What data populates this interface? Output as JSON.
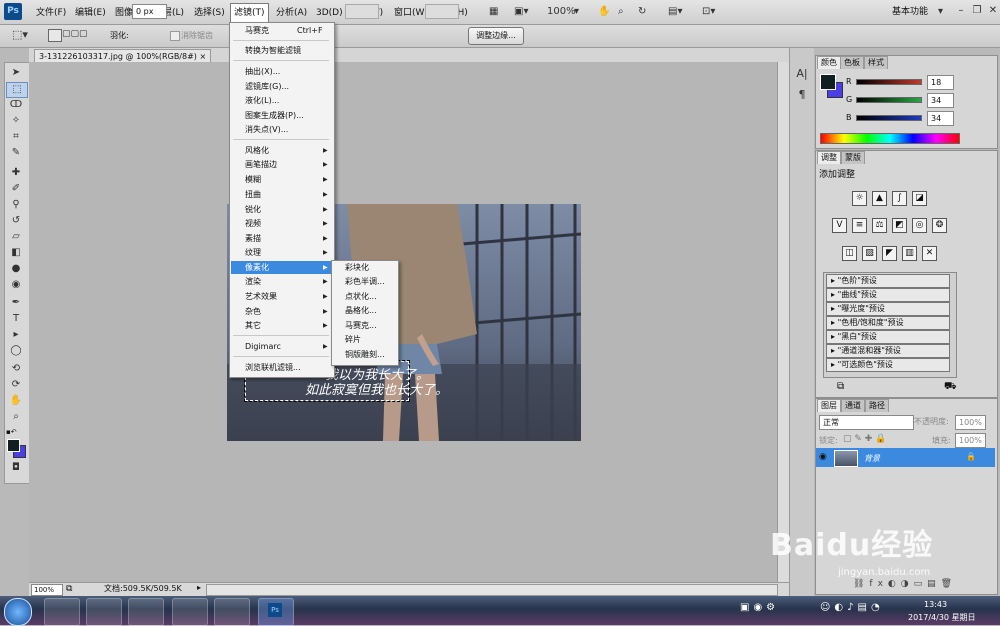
{
  "app": {
    "logo": "Ps"
  },
  "menubar": {
    "items": [
      "文件(F)",
      "编辑(E)",
      "图像(I)",
      "图层(L)",
      "选择(S)",
      "滤镜(T)",
      "分析(A)",
      "3D(D)",
      "视图(V)",
      "窗口(W)",
      "帮助(H)"
    ],
    "zoom_value": "100%",
    "workspace": "基本功能"
  },
  "options_bar": {
    "feather_label": "羽化:",
    "feather_value": "0 px",
    "antialias_label": "消除锯齿",
    "refine_edge_button": "调整边缘..."
  },
  "document": {
    "tab_title": "3-131226103317.jpg @ 100%(RGB/8#)",
    "photo_text_1": "我以为我长大了。",
    "photo_text_2": "如此寂寞但我也长大了。",
    "zoom": "100%",
    "doc_size": "文档:509.5K/509.5K"
  },
  "filter_menu": {
    "last_filter": "马赛克",
    "last_filter_shortcut": "Ctrl+F",
    "smart_filter": "转换为智能滤镜",
    "group1": [
      "抽出(X)...",
      "滤镜库(G)...",
      "液化(L)...",
      "图案生成器(P)...",
      "消失点(V)..."
    ],
    "submenus": [
      "风格化",
      "画笔描边",
      "模糊",
      "扭曲",
      "锐化",
      "视频",
      "素描",
      "纹理",
      "像素化",
      "渲染",
      "艺术效果",
      "杂色",
      "其它"
    ],
    "digimarc": "Digimarc",
    "browse": "浏览联机滤镜..."
  },
  "pixelate_submenu": [
    "彩块化",
    "彩色半调...",
    "点状化...",
    "晶格化...",
    "马赛克...",
    "碎片",
    "铜版雕刻..."
  ],
  "color_panel": {
    "tabs": [
      "颜色",
      "色板",
      "样式"
    ],
    "r_label": "R",
    "r_value": "18",
    "g_label": "G",
    "g_value": "34",
    "b_label": "B",
    "b_value": "34",
    "r_color": "#c0392b",
    "g_color": "#27a844",
    "b_color": "#1f3bc4"
  },
  "adjustments_panel": {
    "tabs": [
      "调整",
      "蒙版"
    ],
    "title": "添加调整",
    "presets": [
      "\"色阶\"预设",
      "\"曲线\"预设",
      "\"曝光度\"预设",
      "\"色相/饱和度\"预设",
      "\"黑白\"预设",
      "\"通道混和器\"预设",
      "\"可选颜色\"预设"
    ]
  },
  "layers_panel": {
    "tabs": [
      "图层",
      "通道",
      "路径"
    ],
    "blend_mode": "正常",
    "opacity_label": "不透明度:",
    "opacity_value": "100%",
    "lock_label": "锁定:",
    "fill_label": "填充:",
    "fill_value": "100%",
    "layer_name": "背景"
  },
  "taskbar": {
    "time": "13:43",
    "date": "2017/4/30 星期日"
  },
  "watermark": {
    "brand": "Baidu经验",
    "url": "jingyan.baidu.com"
  }
}
